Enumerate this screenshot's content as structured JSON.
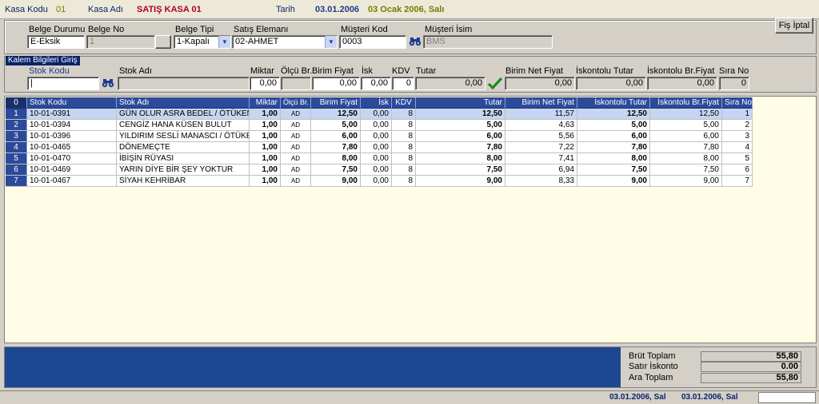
{
  "top": {
    "kasa_kodu_label": "Kasa Kodu",
    "kasa_kodu_value": "01",
    "kasa_adi_label": "Kasa Adı",
    "kasa_adi_value": "SATIŞ KASA 01",
    "tarih_label": "Tarih",
    "tarih_value": "03.01.2006",
    "tarih_long": "03 Ocak 2006, Salı"
  },
  "header": {
    "belge_durumu_label": "Belge Durumu",
    "belge_durumu_value": "E-Eksik",
    "belge_no_label": "Belge No",
    "belge_no_value": "1",
    "belge_tipi_label": "Belge Tipi",
    "belge_tipi_value": "1-Kapalı",
    "satis_elemani_label": "Satış Elemanı",
    "satis_elemani_value": "02-AHMET",
    "musteri_kod_label": "Müşteri Kod",
    "musteri_kod_value": "0003",
    "musteri_isim_label": "Müşteri İsim",
    "musteri_isim_value": "BMS",
    "fis_iptal_label": "Fiş İptal"
  },
  "item_entry": {
    "caption": "Kalem Bilgileri Giriş",
    "stok_kodu_label": "Stok Kodu",
    "stok_kodu_value": "|",
    "stok_adi_label": "Stok Adı",
    "miktar_label": "Miktar",
    "miktar_value": "0,00",
    "olcu_br_label": "Ölçü Br.",
    "birim_fiyat_label": "Birim Fiyat",
    "birim_fiyat_value": "0,00",
    "isk_label": "İsk",
    "isk_value": "0,00",
    "kdv_label": "KDV",
    "kdv_value": "0",
    "tutar_label": "Tutar",
    "tutar_value": "0,00",
    "birim_net_label": "Birim Net Fiyat",
    "birim_net_value": "0,00",
    "iskontolu_tutar_label": "İskontolu Tutar",
    "iskontolu_tutar_value": "0,00",
    "iskontolu_br_label": "İskontolu Br.Fiyat",
    "iskontolu_br_value": "0,00",
    "sira_no_label": "Sıra No",
    "sira_no_value": "0"
  },
  "grid": {
    "headers": [
      "0",
      "Stok Kodu",
      "Stok Adı",
      "Miktar",
      "Ölçü Br.",
      "Birim Fiyat",
      "İsk",
      "KDV",
      "Tutar",
      "Birim Net Fiyat",
      "İskontolu Tutar",
      "İskontolu Br.Fiyat",
      "Sıra No"
    ],
    "rows": [
      [
        "1",
        "10-01-0391",
        "GÜN OLUR ASRA BEDEL / ÖTÜKEN",
        "1,00",
        "AD",
        "12,50",
        "0,00",
        "8",
        "12,50",
        "11,57",
        "12,50",
        "12,50",
        "1"
      ],
      [
        "2",
        "10-01-0394",
        "CENGİZ HANA KÜSEN BULUT",
        "1,00",
        "AD",
        "5,00",
        "0,00",
        "8",
        "5,00",
        "4,63",
        "5,00",
        "5,00",
        "2"
      ],
      [
        "3",
        "10-01-0396",
        "YILDIRIM SESLİ MANASCI / ÖTÜKEN",
        "1,00",
        "AD",
        "6,00",
        "0,00",
        "8",
        "6,00",
        "5,56",
        "6,00",
        "6,00",
        "3"
      ],
      [
        "4",
        "10-01-0465",
        "DÖNEMEÇTE",
        "1,00",
        "AD",
        "7,80",
        "0,00",
        "8",
        "7,80",
        "7,22",
        "7,80",
        "7,80",
        "4"
      ],
      [
        "5",
        "10-01-0470",
        "İBİŞİN RÜYASI",
        "1,00",
        "AD",
        "8,00",
        "0,00",
        "8",
        "8,00",
        "7,41",
        "8,00",
        "8,00",
        "5"
      ],
      [
        "6",
        "10-01-0469",
        "YARIN DİYE BİR ŞEY YOKTUR",
        "1,00",
        "AD",
        "7,50",
        "0,00",
        "8",
        "7,50",
        "6,94",
        "7,50",
        "7,50",
        "6"
      ],
      [
        "7",
        "10-01-0467",
        "SİYAH KEHRİBAR",
        "1,00",
        "AD",
        "9,00",
        "0,00",
        "8",
        "9,00",
        "8,33",
        "9,00",
        "9,00",
        "7"
      ]
    ]
  },
  "totals": {
    "brut_label": "Brüt Toplam",
    "brut_value": "55,80",
    "satir_iskonto_label": "Satır İskonto",
    "satir_iskonto_value": "0.00",
    "ara_toplam_label": "Ara Toplam",
    "ara_toplam_value": "55,80"
  },
  "status": {
    "date1": "03.01.2006, Sal",
    "date2": "03.01.2006, Sal"
  },
  "colors": {
    "grid_header": "#2c4a9a",
    "grid_bg": "#fffde6",
    "selected_row": "#c5d6f3",
    "bottom_blue": "#1c4792"
  }
}
